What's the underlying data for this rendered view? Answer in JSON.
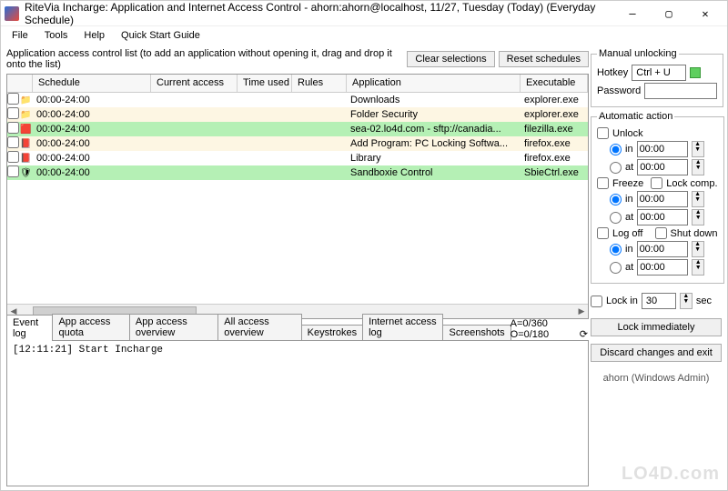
{
  "window": {
    "title": "RiteVia Incharge: Application and Internet Access Control - ahorn:ahorn@localhost, 11/27, Tuesday (Today) (Everyday Schedule)"
  },
  "menu": {
    "file": "File",
    "tools": "Tools",
    "help": "Help",
    "guide": "Quick Start Guide"
  },
  "hint": "Application access control list (to add an application without opening it, drag and drop it onto the list)",
  "buttons": {
    "clear": "Clear selections",
    "reset": "Reset schedules"
  },
  "columns": {
    "schedule": "Schedule",
    "access": "Current access",
    "time": "Time used",
    "rules": "Rules",
    "app": "Application",
    "exe": "Executable"
  },
  "rows": [
    {
      "icon": "📁",
      "schedule": "00:00-24:00",
      "app": "Downloads",
      "exe": "explorer.exe",
      "cls": ""
    },
    {
      "icon": "📁",
      "schedule": "00:00-24:00",
      "app": "Folder Security",
      "exe": "explorer.exe",
      "cls": "cream"
    },
    {
      "icon": "🟥",
      "schedule": "00:00-24:00",
      "app": "sea-02.lo4d.com - sftp://canadia...",
      "exe": "filezilla.exe",
      "cls": "green"
    },
    {
      "icon": "📕",
      "schedule": "00:00-24:00",
      "app": "Add Program: PC Locking Softwa...",
      "exe": "firefox.exe",
      "cls": "cream"
    },
    {
      "icon": "📕",
      "schedule": "00:00-24:00",
      "app": "Library",
      "exe": "firefox.exe",
      "cls": ""
    },
    {
      "icon": "🛡",
      "schedule": "00:00-24:00",
      "app": "Sandboxie Control",
      "exe": "SbieCtrl.exe",
      "cls": "green"
    }
  ],
  "tabs": {
    "t0": "Event log",
    "t1": "App access quota",
    "t2": "App access overview",
    "t3": "All access overview",
    "t4": "Keystrokes",
    "t5": "Internet access log",
    "t6": "Screenshots"
  },
  "stats": "A=0/360   O=0/180",
  "log": "[12:11:21] Start Incharge",
  "manual": {
    "legend": "Manual unlocking",
    "hotkey": "Hotkey",
    "hotkey_val": "Ctrl + U",
    "password": "Password"
  },
  "auto": {
    "legend": "Automatic action",
    "unlock": "Unlock",
    "freeze": "Freeze",
    "lockcomp": "Lock comp.",
    "logoff": "Log off",
    "shutdown": "Shut down",
    "in": "in",
    "at": "at",
    "t": "00:00"
  },
  "lockin": {
    "label": "Lock in",
    "val": "30",
    "sec": "sec"
  },
  "actions": {
    "locknow": "Lock immediately",
    "discard": "Discard changes and exit"
  },
  "user": "ahorn (Windows Admin)",
  "watermark": "LO4D.com"
}
